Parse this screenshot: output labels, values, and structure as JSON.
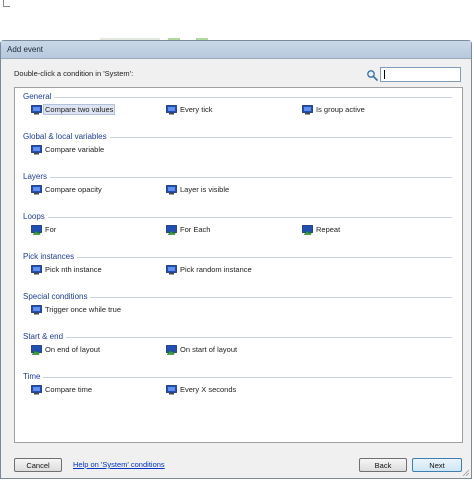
{
  "dialog": {
    "title": "Add event",
    "prompt": "Double-click a condition in 'System':",
    "search": {
      "value": "",
      "placeholder": ""
    }
  },
  "groups": [
    {
      "title": "General",
      "items": [
        {
          "label": "Compare two values",
          "icon": "system-monitor-icon",
          "selected": true
        },
        {
          "label": "Every tick",
          "icon": "system-monitor-icon"
        },
        {
          "label": "Is group active",
          "icon": "system-monitor-icon"
        }
      ]
    },
    {
      "title": "Global & local variables",
      "items": [
        {
          "label": "Compare variable",
          "icon": "system-monitor-icon"
        }
      ]
    },
    {
      "title": "Layers",
      "items": [
        {
          "label": "Compare opacity",
          "icon": "system-monitor-icon"
        },
        {
          "label": "Layer is visible",
          "icon": "system-monitor-icon"
        }
      ]
    },
    {
      "title": "Loops",
      "items": [
        {
          "label": "For",
          "icon": "loop-arrow-icon"
        },
        {
          "label": "For Each",
          "icon": "loop-arrow-icon"
        },
        {
          "label": "Repeat",
          "icon": "loop-arrow-icon"
        }
      ]
    },
    {
      "title": "Pick instances",
      "items": [
        {
          "label": "Pick nth instance",
          "icon": "system-monitor-icon"
        },
        {
          "label": "Pick random instance",
          "icon": "system-monitor-icon"
        }
      ]
    },
    {
      "title": "Special conditions",
      "items": [
        {
          "label": "Trigger once while true",
          "icon": "system-monitor-icon"
        }
      ]
    },
    {
      "title": "Start & end",
      "items": [
        {
          "label": "On end of layout",
          "icon": "trigger-arrow-icon"
        },
        {
          "label": "On start of layout",
          "icon": "trigger-arrow-icon"
        }
      ]
    },
    {
      "title": "Time",
      "items": [
        {
          "label": "Compare time",
          "icon": "system-monitor-icon"
        },
        {
          "label": "Every X seconds",
          "icon": "system-monitor-icon"
        }
      ]
    }
  ],
  "footer": {
    "cancel_label": "Cancel",
    "help_label": "Help on 'System' conditions",
    "back_label": "Back",
    "next_label": "Next"
  },
  "colors": {
    "group_title": "#1f3c9c",
    "link": "#0033cc",
    "icon_blue": "#1f4fb5",
    "icon_green": "#3aa13a"
  }
}
